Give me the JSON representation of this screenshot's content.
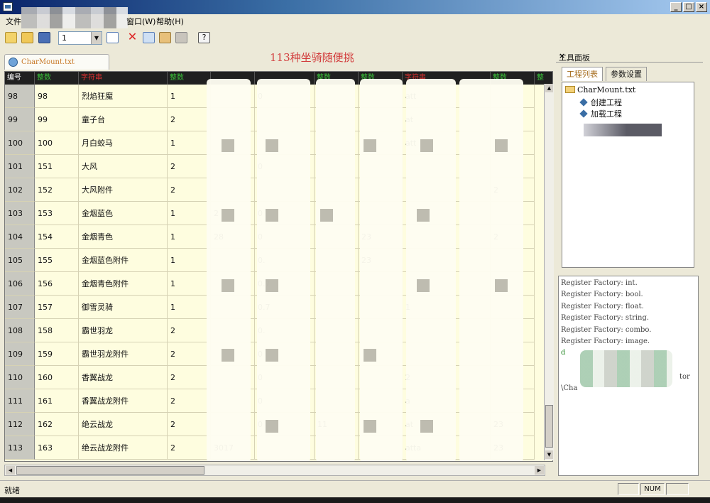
{
  "window": {
    "title": "",
    "title_blurred": true,
    "controls": [
      "_",
      "□",
      "×"
    ]
  },
  "menu": {
    "items": [
      "文件",
      "窗口(W)",
      "帮助(H)"
    ]
  },
  "toolbar": {
    "combo_value": "1",
    "banner_text": "113种坐骑随便挑",
    "icons": [
      "new-icon",
      "open-icon",
      "save-icon",
      "window-icon",
      "delete-icon",
      "copy-icon",
      "paste-icon",
      "tool-icon",
      "help-icon"
    ]
  },
  "document": {
    "tab_label": "CharMount.txt"
  },
  "grid": {
    "columns": [
      {
        "label": "编号",
        "color": "#ffffff"
      },
      {
        "label": "整数",
        "color": "#39c139"
      },
      {
        "label": "字符串",
        "color": "#e03030"
      },
      {
        "label": "整数",
        "color": "#39c139"
      },
      {
        "label": "",
        "color": "#39c139"
      },
      {
        "label": "",
        "color": "#39c139"
      },
      {
        "label": "整数",
        "color": "#39c139"
      },
      {
        "label": "整数",
        "color": "#39c139"
      },
      {
        "label": "字符串",
        "color": "#e03030"
      },
      {
        "label": "整数",
        "color": "#39c139"
      },
      {
        "label": "整",
        "color": "#39c139"
      }
    ],
    "rows": [
      {
        "num": "98",
        "id": "98",
        "name": "烈焰狂魔",
        "type": "1",
        "c4": "",
        "c5": "0",
        "c6": "",
        "c7": "",
        "c8": "att",
        "c9": ""
      },
      {
        "num": "99",
        "id": "99",
        "name": "童子台",
        "type": "2",
        "c4": "",
        "c5": "",
        "c6": "",
        "c7": "",
        "c8": "at",
        "c9": ""
      },
      {
        "num": "100",
        "id": "100",
        "name": "月白蛟马",
        "type": "1",
        "c4": "",
        "c5": "",
        "c6": "",
        "c7": "",
        "c8": "att",
        "c9": ""
      },
      {
        "num": "101",
        "id": "151",
        "name": "大风",
        "type": "2",
        "c4": "",
        "c5": "0",
        "c6": "",
        "c7": "",
        "c8": "",
        "c9": ""
      },
      {
        "num": "102",
        "id": "152",
        "name": "大风附件",
        "type": "2",
        "c4": "",
        "c5": "",
        "c6": "",
        "c7": "",
        "c8": "",
        "c9": "2"
      },
      {
        "num": "103",
        "id": "153",
        "name": "金烟蓝色",
        "type": "1",
        "c4": "2",
        "c5": "0",
        "c6": "",
        "c7": "",
        "c8": "",
        "c9": ""
      },
      {
        "num": "104",
        "id": "154",
        "name": "金烟青色",
        "type": "1",
        "c4": "28",
        "c5": "0",
        "c6": "",
        "c7": "23",
        "c8": "",
        "c9": "2"
      },
      {
        "num": "105",
        "id": "155",
        "name": "金烟蓝色附件",
        "type": "1",
        "c4": "",
        "c5": "0.",
        "c6": "",
        "c7": "23",
        "c8": "",
        "c9": ""
      },
      {
        "num": "106",
        "id": "156",
        "name": "金烟青色附件",
        "type": "1",
        "c4": "",
        "c5": "0.7",
        "c6": "",
        "c7": "",
        "c8": "",
        "c9": ""
      },
      {
        "num": "107",
        "id": "157",
        "name": "御雪灵骑",
        "type": "1",
        "c4": "",
        "c5": "0.7",
        "c6": "",
        "c7": "",
        "c8": "1",
        "c9": ""
      },
      {
        "num": "108",
        "id": "158",
        "name": "霸世羽龙",
        "type": "2",
        "c4": "",
        "c5": "0.",
        "c6": "",
        "c7": "",
        "c8": "",
        "c9": ""
      },
      {
        "num": "109",
        "id": "159",
        "name": "霸世羽龙附件",
        "type": "2",
        "c4": "",
        "c5": "0",
        "c6": "",
        "c7": "",
        "c8": "",
        "c9": ""
      },
      {
        "num": "110",
        "id": "160",
        "name": "香翼战龙",
        "type": "2",
        "c4": "",
        "c5": "0",
        "c6": "",
        "c7": "",
        "c8": "2",
        "c9": ""
      },
      {
        "num": "111",
        "id": "161",
        "name": "香翼战龙附件",
        "type": "2",
        "c4": "",
        "c5": "0",
        "c6": "",
        "c7": "",
        "c8": "a",
        "c9": ""
      },
      {
        "num": "112",
        "id": "162",
        "name": "绝云战龙",
        "type": "2",
        "c4": "",
        "c5": "0",
        "c6": "11",
        "c7": "",
        "c8": "at",
        "c9": "23"
      },
      {
        "num": "113",
        "id": "163",
        "name": "绝云战龙附件",
        "type": "2",
        "c4": "3017",
        "c5": "",
        "c6": "",
        "c7": "",
        "c8": "atta",
        "c9": "23"
      }
    ]
  },
  "tool_panel": {
    "title": "工具面板",
    "tabs": [
      "工程列表",
      "参数设置"
    ],
    "tree": {
      "root": "CharMount.txt",
      "children": [
        "创建工程",
        "加载工程"
      ]
    },
    "log": [
      "Register Factory: int.",
      "Register Factory: bool.",
      "Register Factory: float.",
      "Register Factory: string.",
      "Register Factory: combo.",
      "Register Factory: image.",
      "d",
      "tor",
      "\\Cha"
    ]
  },
  "status": {
    "text": "就绪",
    "indicator": "NUM"
  }
}
